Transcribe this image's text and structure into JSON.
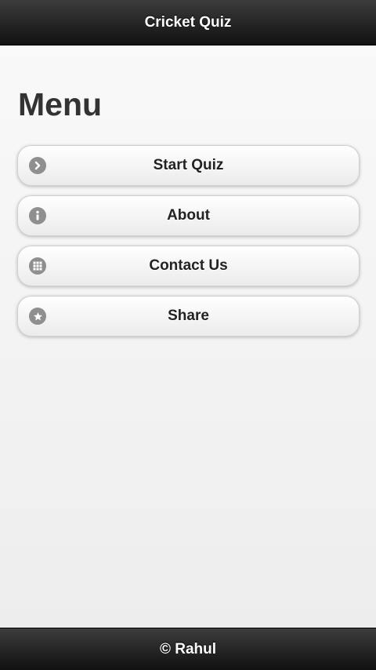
{
  "header": {
    "title": "Cricket Quiz"
  },
  "main": {
    "title": "Menu",
    "menu_items": [
      {
        "label": "Start Quiz",
        "icon": "arrow-right-icon"
      },
      {
        "label": "About",
        "icon": "info-icon"
      },
      {
        "label": "Contact Us",
        "icon": "grid-icon"
      },
      {
        "label": "Share",
        "icon": "star-icon"
      }
    ]
  },
  "footer": {
    "text": "© Rahul"
  },
  "colors": {
    "bar_dark": "#111111",
    "icon_gray": "#8f8f8f",
    "page_bg": "#f0f0f0"
  }
}
